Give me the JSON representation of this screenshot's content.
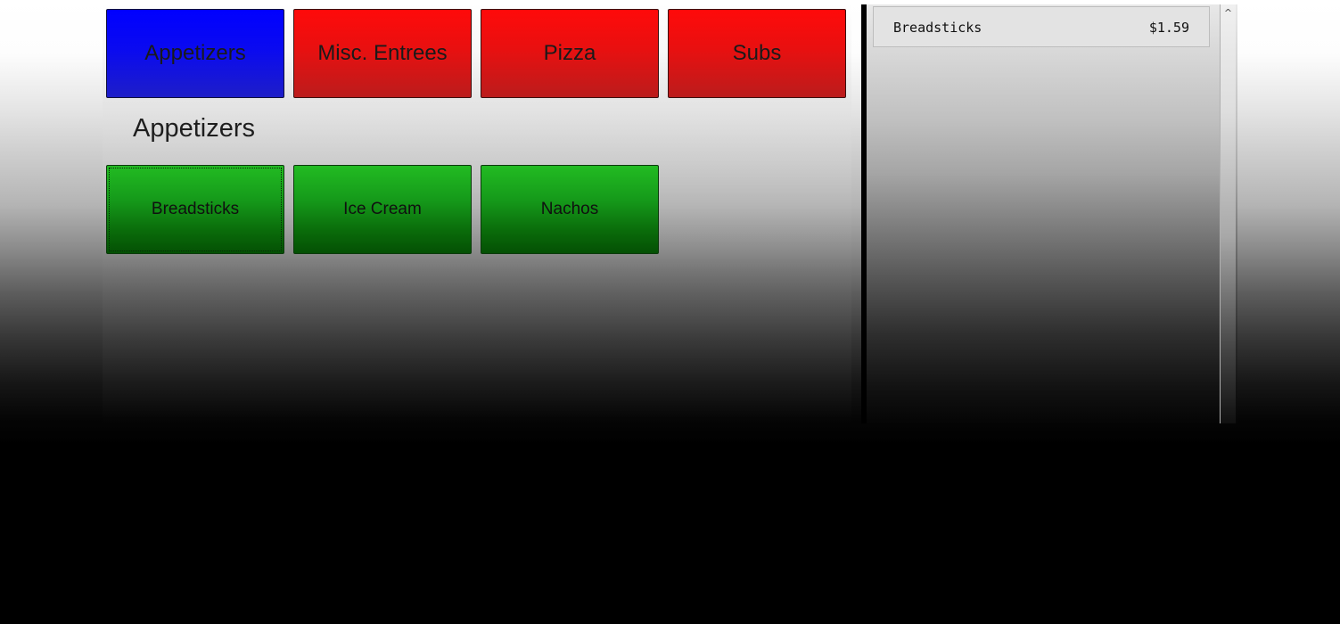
{
  "categories": [
    {
      "label": "Appetizers",
      "selected": true
    },
    {
      "label": "Misc. Entrees",
      "selected": false
    },
    {
      "label": "Pizza",
      "selected": false
    },
    {
      "label": "Subs",
      "selected": false
    }
  ],
  "section_title": "Appetizers",
  "items": [
    {
      "label": "Breadsticks"
    },
    {
      "label": "Ice Cream"
    },
    {
      "label": "Nachos"
    }
  ],
  "order": {
    "lines": [
      {
        "name": "Breadsticks",
        "price": "$1.59"
      }
    ]
  },
  "icons": {
    "scroll_up": "^"
  },
  "colors": {
    "category_selected": "#0000ff",
    "category_default": "#ff0a0a",
    "item_button": "#1a9e1a"
  }
}
